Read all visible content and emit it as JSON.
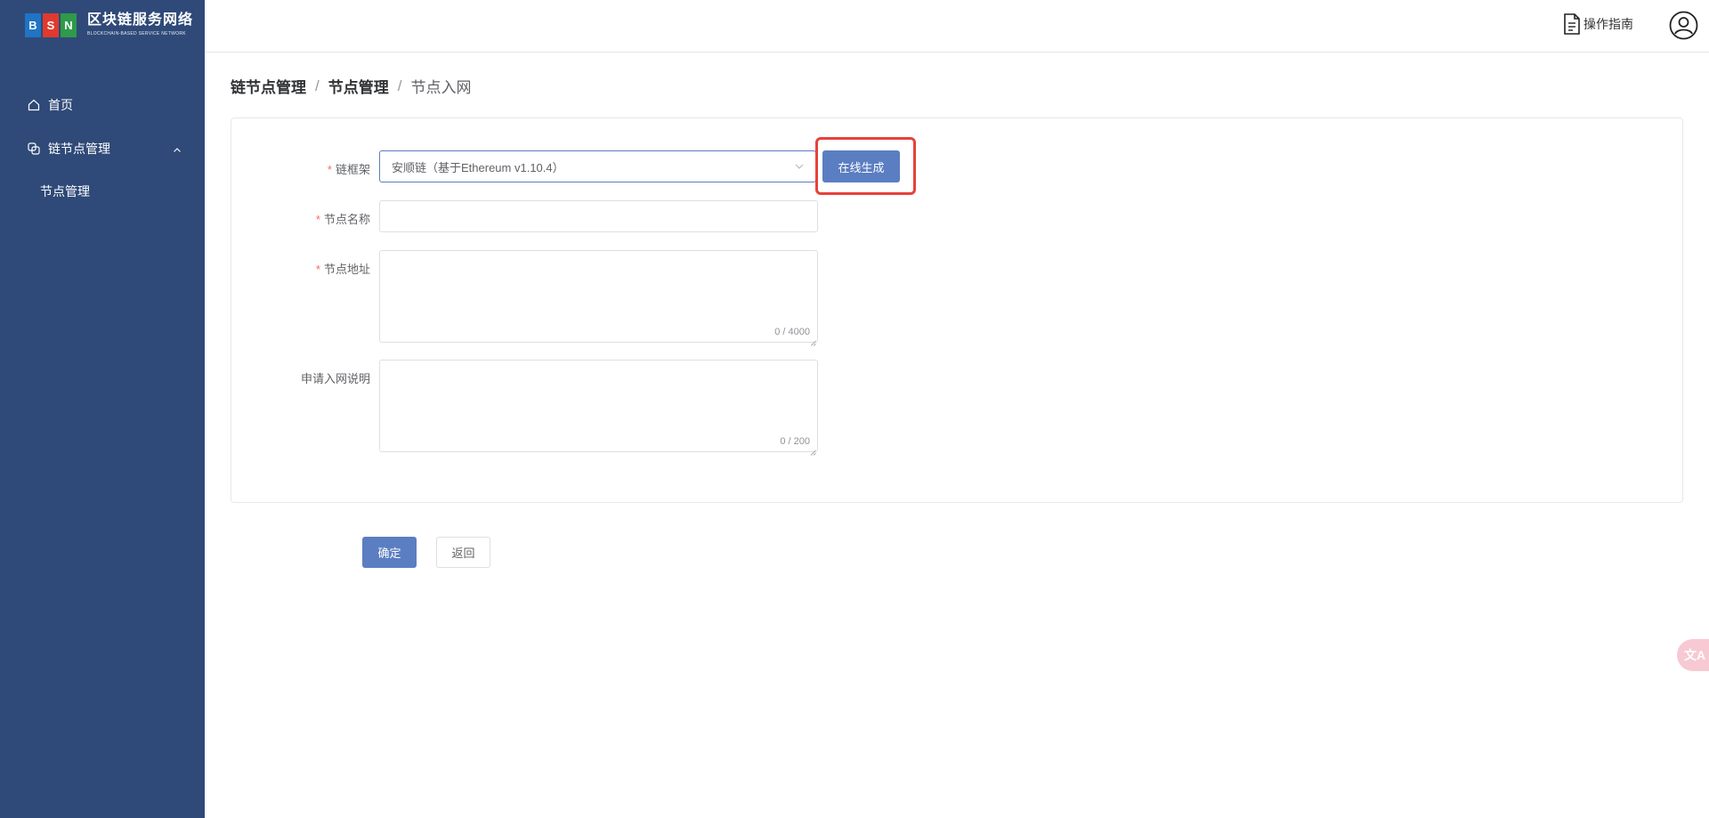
{
  "colors": {
    "sidebar_bg": "#2f4a78",
    "primary": "#5b7ec2",
    "highlight": "#e8413b",
    "required": "#f56c6c"
  },
  "logo": {
    "letters": [
      "B",
      "S",
      "N"
    ],
    "title": "区块链服务网络",
    "subtitle": "BLOCKCHAIN-BASED SERVICE NETWORK"
  },
  "sidebar": {
    "items": [
      {
        "label": "首页",
        "icon": "home-icon"
      },
      {
        "label": "链节点管理",
        "icon": "link-icon",
        "expanded": true,
        "children": [
          {
            "label": "节点管理"
          }
        ]
      }
    ]
  },
  "header": {
    "guide_label": "操作指南",
    "guide_icon": "document-icon",
    "avatar_icon": "user-avatar-icon"
  },
  "breadcrumb": {
    "items": [
      "链节点管理",
      "节点管理",
      "节点入网"
    ],
    "separator": "/"
  },
  "form": {
    "required_mark": "*",
    "framework": {
      "label": "链框架",
      "value": "安顺链（基于Ethereum v1.10.4）",
      "generate_button": "在线生成"
    },
    "node_name": {
      "label": "节点名称",
      "value": ""
    },
    "node_address": {
      "label": "节点地址",
      "value": "",
      "counter": "0 / 4000"
    },
    "description": {
      "label": "申请入网说明",
      "value": "",
      "counter": "0 / 200"
    }
  },
  "actions": {
    "confirm": "确定",
    "back": "返回"
  },
  "translate_button": {
    "label": "文A",
    "icon": "translate-icon"
  }
}
